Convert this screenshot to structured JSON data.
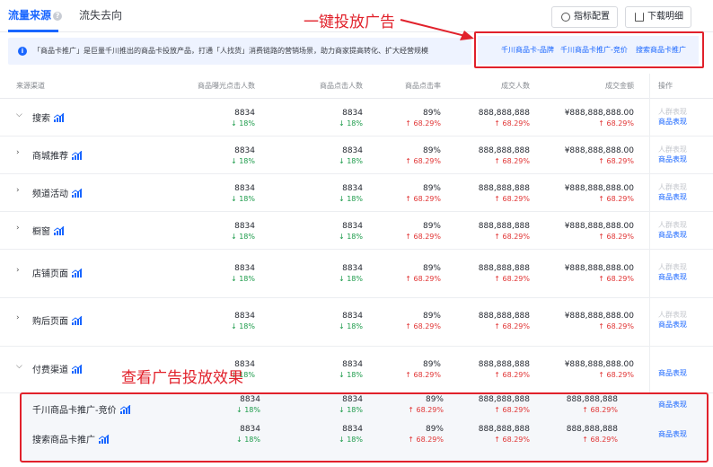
{
  "tabs": {
    "active": "流量来源",
    "inactive": "流失去向"
  },
  "toolbar": {
    "metrics_button": "指标配置",
    "download_button": "下载明细"
  },
  "info_banner": "「商品卡推广」是巨量千川推出的商品卡投放产品，打通「人找货」消费链路的营销场景，助力商家提高转化、扩大经营规模",
  "ad_links": [
    "千川商品卡-品牌",
    "千川商品卡推广-竞价",
    "搜索商品卡推广"
  ],
  "annotations": {
    "one_click": "一键投放广告",
    "view_effect": "查看广告投放效果"
  },
  "columns": [
    "来源渠道",
    "商品曝光点击人数",
    "商品点击人数",
    "商品点击率",
    "成交人数",
    "成交金额",
    "操作"
  ],
  "actions": {
    "crowd": "人群表现",
    "product": "商品表现"
  },
  "rows": [
    {
      "name": "搜索",
      "expanded": true,
      "exposure": "8834",
      "exposure_delta": "18%",
      "clicks": "8834",
      "clicks_delta": "18%",
      "ctr": "89%",
      "ctr_delta": "68.29%",
      "buyers": "888,888,888",
      "buyers_delta": "68.29%",
      "amount": "¥888,888,888.00",
      "amount_delta": "68.29%"
    },
    {
      "name": "商城推荐",
      "expanded": false,
      "exposure": "8834",
      "exposure_delta": "18%",
      "clicks": "8834",
      "clicks_delta": "18%",
      "ctr": "89%",
      "ctr_delta": "68.29%",
      "buyers": "888,888,888",
      "buyers_delta": "68.29%",
      "amount": "¥888,888,888.00",
      "amount_delta": "68.29%"
    },
    {
      "name": "频道活动",
      "expanded": false,
      "exposure": "8834",
      "exposure_delta": "18%",
      "clicks": "8834",
      "clicks_delta": "18%",
      "ctr": "89%",
      "ctr_delta": "68.29%",
      "buyers": "888,888,888",
      "buyers_delta": "68.29%",
      "amount": "¥888,888,888.00",
      "amount_delta": "68.29%"
    },
    {
      "name": "橱窗",
      "expanded": false,
      "exposure": "8834",
      "exposure_delta": "18%",
      "clicks": "8834",
      "clicks_delta": "18%",
      "ctr": "89%",
      "ctr_delta": "68.29%",
      "buyers": "888,888,888",
      "buyers_delta": "68.29%",
      "amount": "¥888,888,888.00",
      "amount_delta": "68.29%"
    },
    {
      "name": "店铺页面",
      "expanded": false,
      "exposure": "8834",
      "exposure_delta": "18%",
      "clicks": "8834",
      "clicks_delta": "18%",
      "ctr": "89%",
      "ctr_delta": "68.29%",
      "buyers": "888,888,888",
      "buyers_delta": "68.29%",
      "amount": "¥888,888,888.00",
      "amount_delta": "68.29%"
    },
    {
      "name": "购后页面",
      "expanded": false,
      "exposure": "8834",
      "exposure_delta": "18%",
      "clicks": "8834",
      "clicks_delta": "18%",
      "ctr": "89%",
      "ctr_delta": "68.29%",
      "buyers": "888,888,888",
      "buyers_delta": "68.29%",
      "amount": "¥888,888,888.00",
      "amount_delta": "68.29%"
    },
    {
      "name": "付费渠道",
      "expanded": true,
      "exposure": "8834",
      "exposure_delta": "18%",
      "clicks": "8834",
      "clicks_delta": "18%",
      "ctr": "89%",
      "ctr_delta": "68.29%",
      "buyers": "888,888,888",
      "buyers_delta": "68.29%",
      "amount": "¥888,888,888.00",
      "amount_delta": "68.29%"
    }
  ],
  "sub_rows": [
    {
      "name": "千川商品卡推广-竞价",
      "exposure": "8834",
      "exposure_delta": "18%",
      "clicks": "8834",
      "clicks_delta": "18%",
      "ctr": "89%",
      "ctr_delta": "68.29%",
      "buyers": "888,888,888",
      "buyers_delta": "68.29%",
      "amount": "888,888,888",
      "amount_delta": "68.29%"
    },
    {
      "name": "搜索商品卡推广",
      "exposure": "8834",
      "exposure_delta": "18%",
      "clicks": "8834",
      "clicks_delta": "18%",
      "ctr": "89%",
      "ctr_delta": "68.29%",
      "buyers": "888,888,888",
      "buyers_delta": "68.29%",
      "amount": "888,888,888",
      "amount_delta": "68.29%"
    }
  ],
  "colors": {
    "accent": "#1966ff",
    "up": "#e13535",
    "down": "#1c9b4a",
    "annotation": "#e1212b"
  }
}
